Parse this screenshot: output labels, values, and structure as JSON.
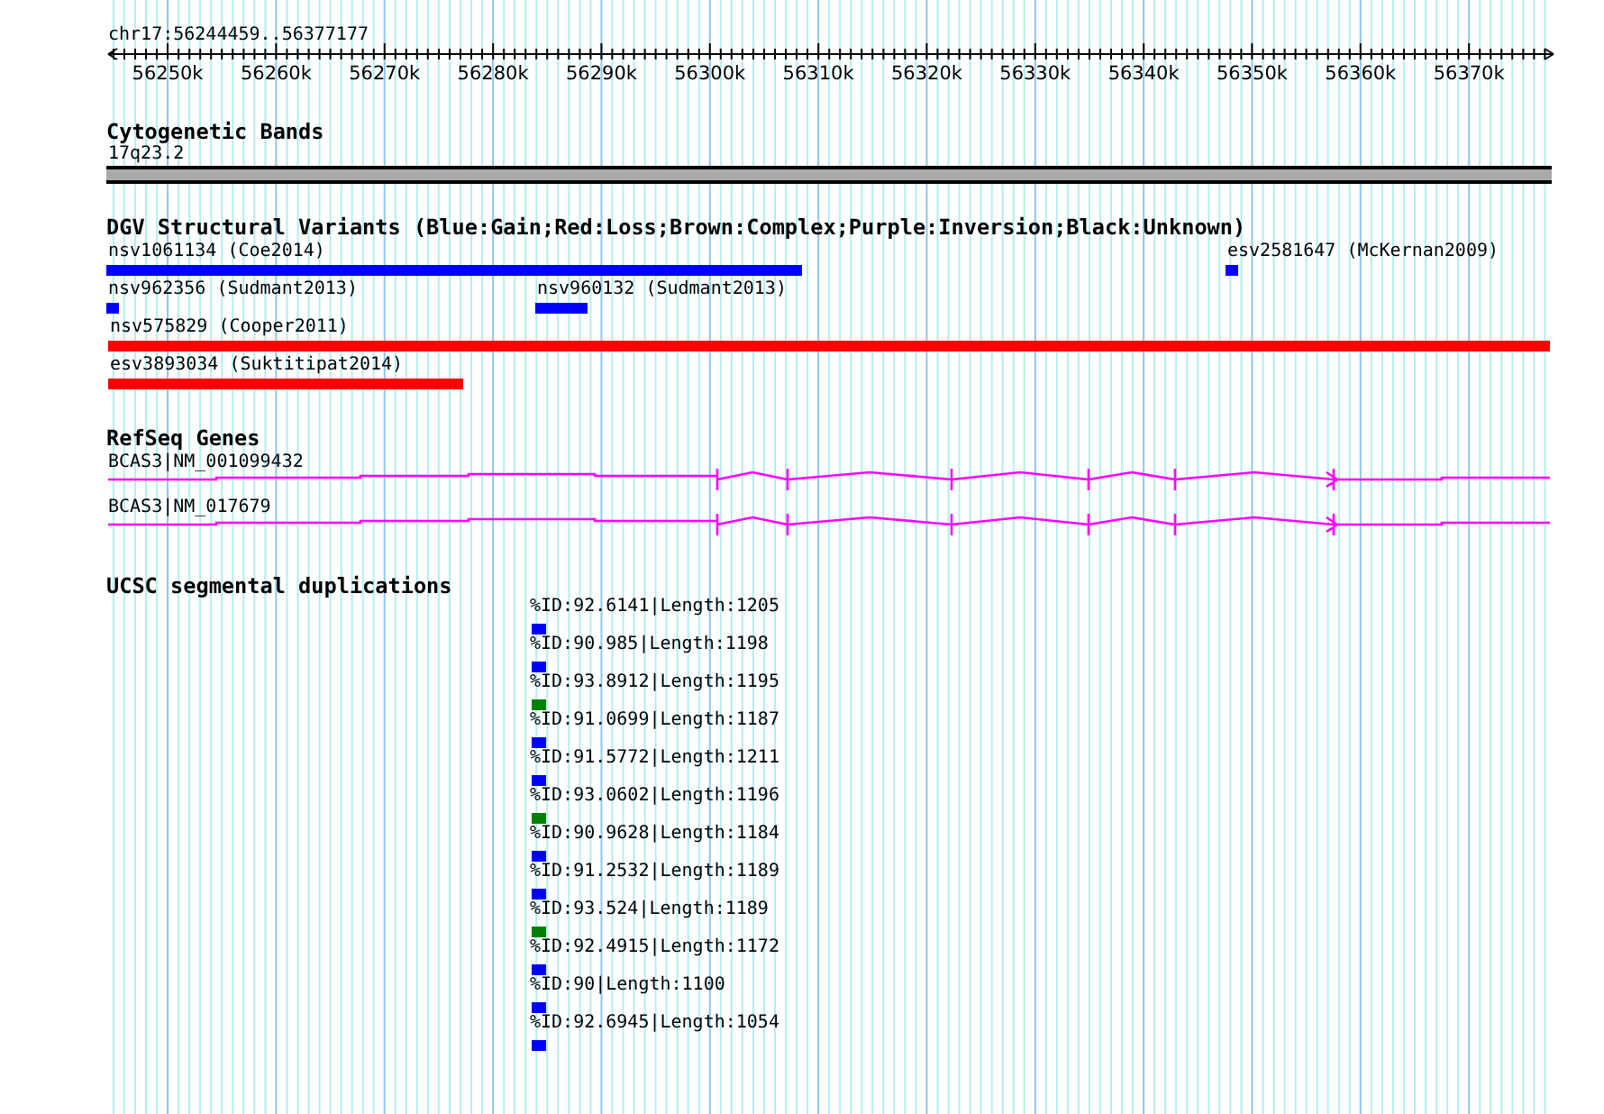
{
  "ruler": {
    "range": "chr17:56244459..56377177",
    "ticks": [
      "56250k",
      "56260k",
      "56270k",
      "56280k",
      "56290k",
      "56300k",
      "56310k",
      "56320k",
      "56330k",
      "56340k",
      "56350k",
      "56360k",
      "56370k"
    ]
  },
  "cytogenetic_bands": {
    "title": "Cytogenetic Bands",
    "bands": [
      {
        "label": "17q23.2"
      }
    ]
  },
  "dgv_variants": {
    "title": "DGV Structural Variants (Blue:Gain;Red:Loss;Brown:Complex;Purple:Inversion;Black:Unknown)",
    "features": [
      {
        "label": "nsv1061134 (Coe2014)",
        "color": "#0000ff"
      },
      {
        "label": "esv2581647 (McKernan2009)",
        "color": "#0000ff"
      },
      {
        "label": "nsv962356 (Sudmant2013)",
        "color": "#0000ff"
      },
      {
        "label": "nsv960132 (Sudmant2013)",
        "color": "#0000ff"
      },
      {
        "label": "nsv575829 (Cooper2011)",
        "color": "#ff0000"
      },
      {
        "label": "esv3893034 (Suktitipat2014)",
        "color": "#ff0000"
      }
    ]
  },
  "refseq_genes": {
    "title": "RefSeq Genes",
    "transcripts": [
      {
        "label": "BCAS3|NM_001099432"
      },
      {
        "label": "BCAS3|NM_017679"
      }
    ]
  },
  "segmental_duplications": {
    "title": "UCSC segmental duplications",
    "features": [
      {
        "label": "%ID:92.6141|Length:1205",
        "color": "#0000ff"
      },
      {
        "label": "%ID:90.985|Length:1198",
        "color": "#0000ff"
      },
      {
        "label": "%ID:93.8912|Length:1195",
        "color": "#008000"
      },
      {
        "label": "%ID:91.0699|Length:1187",
        "color": "#0000ff"
      },
      {
        "label": "%ID:91.5772|Length:1211",
        "color": "#0000ff"
      },
      {
        "label": "%ID:93.0602|Length:1196",
        "color": "#008000"
      },
      {
        "label": "%ID:90.9628|Length:1184",
        "color": "#0000ff"
      },
      {
        "label": "%ID:91.2532|Length:1189",
        "color": "#0000ff"
      },
      {
        "label": "%ID:93.524|Length:1189",
        "color": "#008000"
      },
      {
        "label": "%ID:92.4915|Length:1172",
        "color": "#0000ff"
      },
      {
        "label": "%ID:90|Length:1100",
        "color": "#0000ff"
      },
      {
        "label": "%ID:92.6945|Length:1054",
        "color": "#0000ff"
      }
    ]
  }
}
